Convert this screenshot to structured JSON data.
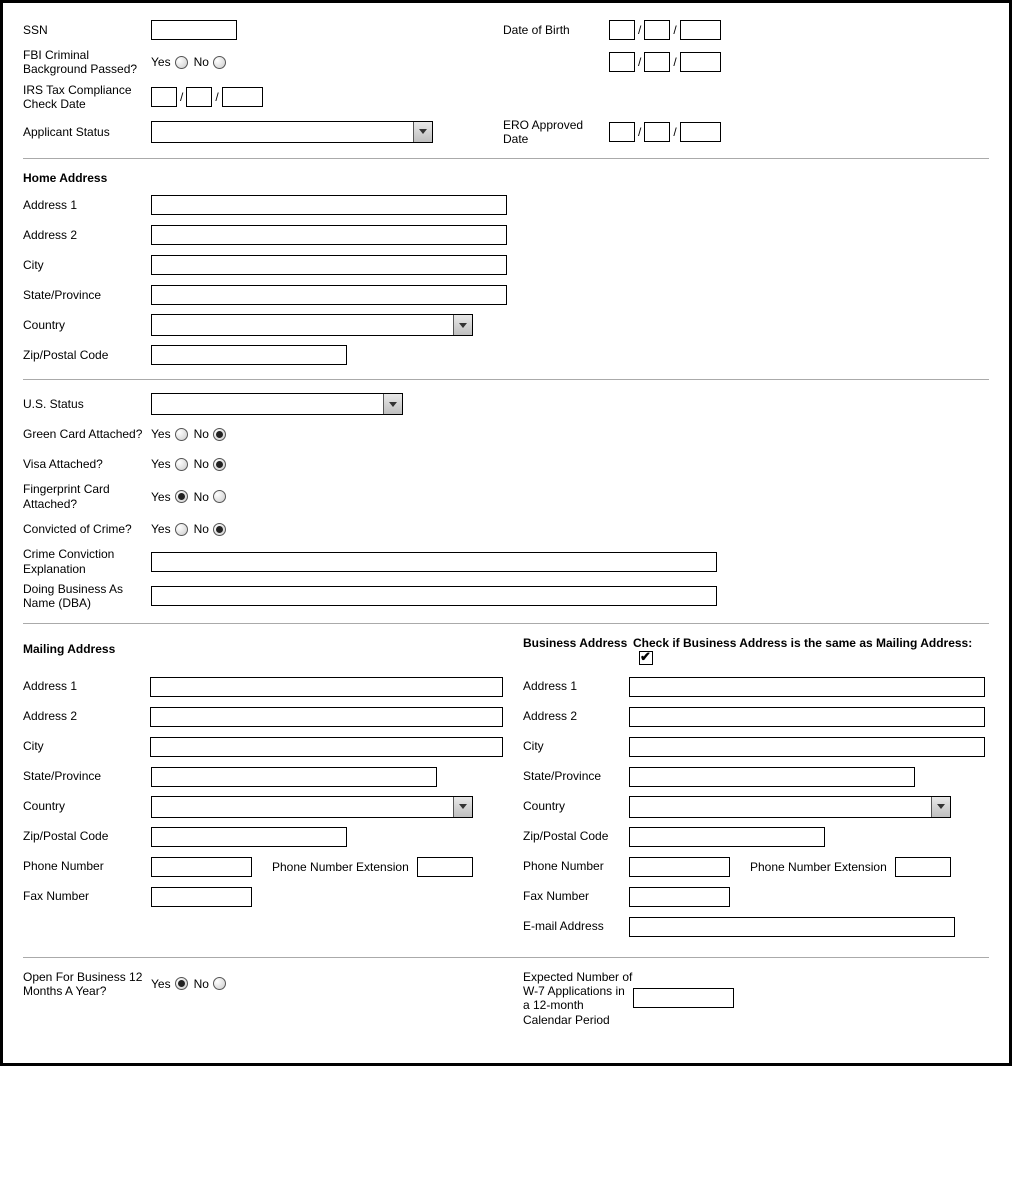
{
  "labels": {
    "ssn": "SSN",
    "dob": "Date of Birth",
    "fbi": "FBI Criminal Background Passed?",
    "irs_date": "IRS Tax Compliance Check Date",
    "applicant_status": "Applicant Status",
    "ero_approved": "ERO Approved Date",
    "home_address": "Home Address",
    "address1": "Address 1",
    "address2": "Address 2",
    "city": "City",
    "state": "State/Province",
    "country": "Country",
    "zip": "Zip/Postal Code",
    "us_status": "U.S. Status",
    "green_card": "Green Card Attached?",
    "visa": "Visa Attached?",
    "fingerprint": "Fingerprint Card Attached?",
    "convicted": "Convicted of Crime?",
    "crime_expl": "Crime Conviction Explanation",
    "dba": "Doing Business As Name (DBA)",
    "mailing_address": "Mailing Address",
    "business_address": "Business Address",
    "same_as_mailing": "Check if Business Address is the same as Mailing Address:",
    "phone": "Phone Number",
    "phone_ext": "Phone Number Extension",
    "fax": "Fax Number",
    "email": "E-mail Address",
    "open12": "Open For Business 12 Months A Year?",
    "w7": "Expected Number of W-7 Applications in a 12-month Calendar Period",
    "yes": "Yes",
    "no": "No",
    "slash": "/"
  }
}
